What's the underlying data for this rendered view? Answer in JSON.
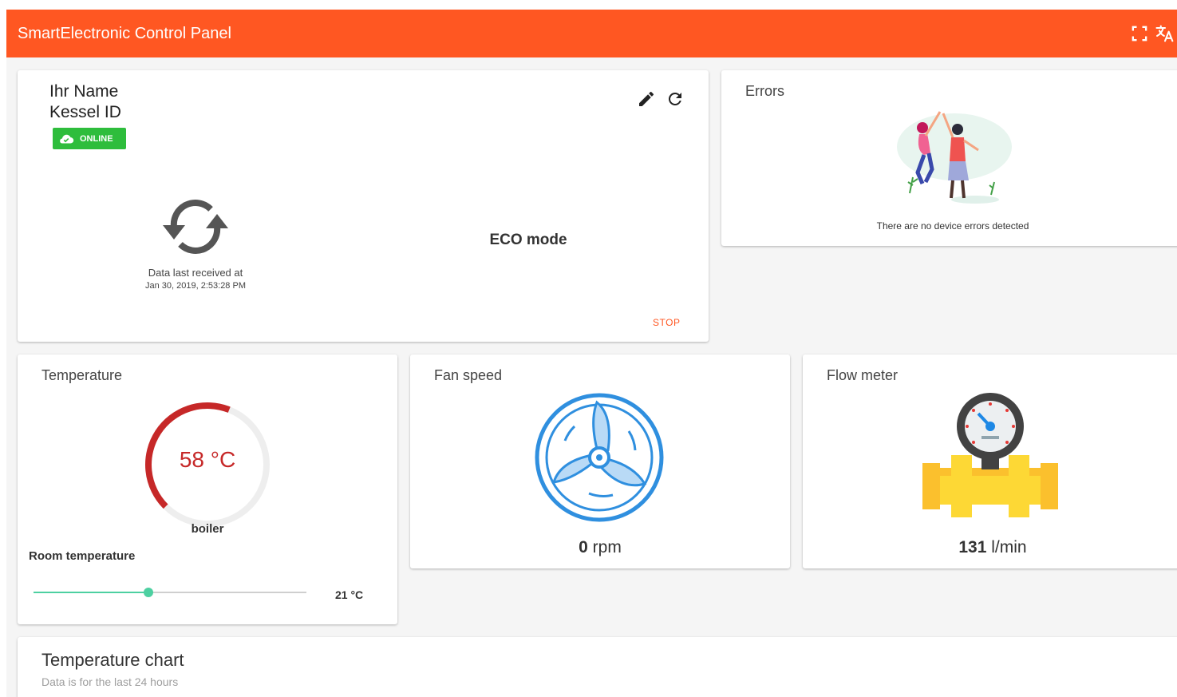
{
  "app": {
    "title": "SmartElectronic Control Panel",
    "fullscreen_icon": "fullscreen-icon",
    "translate_icon": "translate-icon",
    "brand_color": "#ff5722"
  },
  "status_card": {
    "name": "Ihr Name",
    "device_id": "Kessel ID",
    "status_badge": "ONLINE",
    "last_received_label": "Data last received at",
    "last_received_time": "Jan 30, 2019, 2:53:28 PM",
    "mode": "ECO mode",
    "stop_label": "STOP"
  },
  "errors_card": {
    "title": "Errors",
    "message": "There are no device errors detected"
  },
  "temperature_card": {
    "title": "Temperature",
    "value": "58 °C",
    "value_fraction": 0.58,
    "gauge_label": "boiler",
    "room_label": "Room temperature",
    "room_value": "21 °C",
    "room_slider_fraction": 0.42,
    "gauge_color": "#c62828",
    "slider_color": "#4dd0a1"
  },
  "fan_card": {
    "title": "Fan speed",
    "value": "0",
    "unit": "rpm"
  },
  "flow_card": {
    "title": "Flow meter",
    "value": "131",
    "unit": "l/min"
  },
  "chart_card": {
    "title": "Temperature chart",
    "subtitle": "Data is for the last 24 hours"
  }
}
